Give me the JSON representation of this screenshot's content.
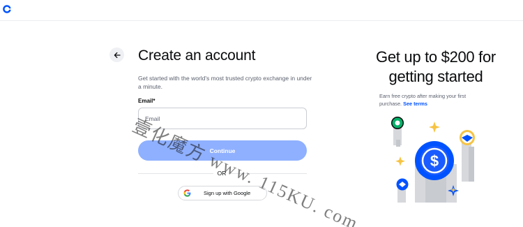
{
  "header": {
    "logo_icon": "coinbase-logo-icon"
  },
  "signup": {
    "back_icon": "arrow-left-icon",
    "title": "Create an account",
    "subtitle": "Get started with the world's most trusted crypto exchange in under a minute.",
    "email_label": "Email*",
    "email_placeholder": "Email",
    "email_value": "",
    "continue_label": "Continue",
    "or_label": "OR",
    "google_icon": "google-g-icon",
    "google_label": "Sign up with Google"
  },
  "promo": {
    "title": "Get up to $200 for getting started",
    "text": "Earn free crypto after making your first purchase.",
    "terms_label": "See terms"
  },
  "watermark": {
    "text": "壹化魔方 www. 115KU. com"
  },
  "colors": {
    "brand_blue": "#0052ff",
    "button_disabled": "#8fb0ff",
    "text_secondary": "#5b616e"
  }
}
